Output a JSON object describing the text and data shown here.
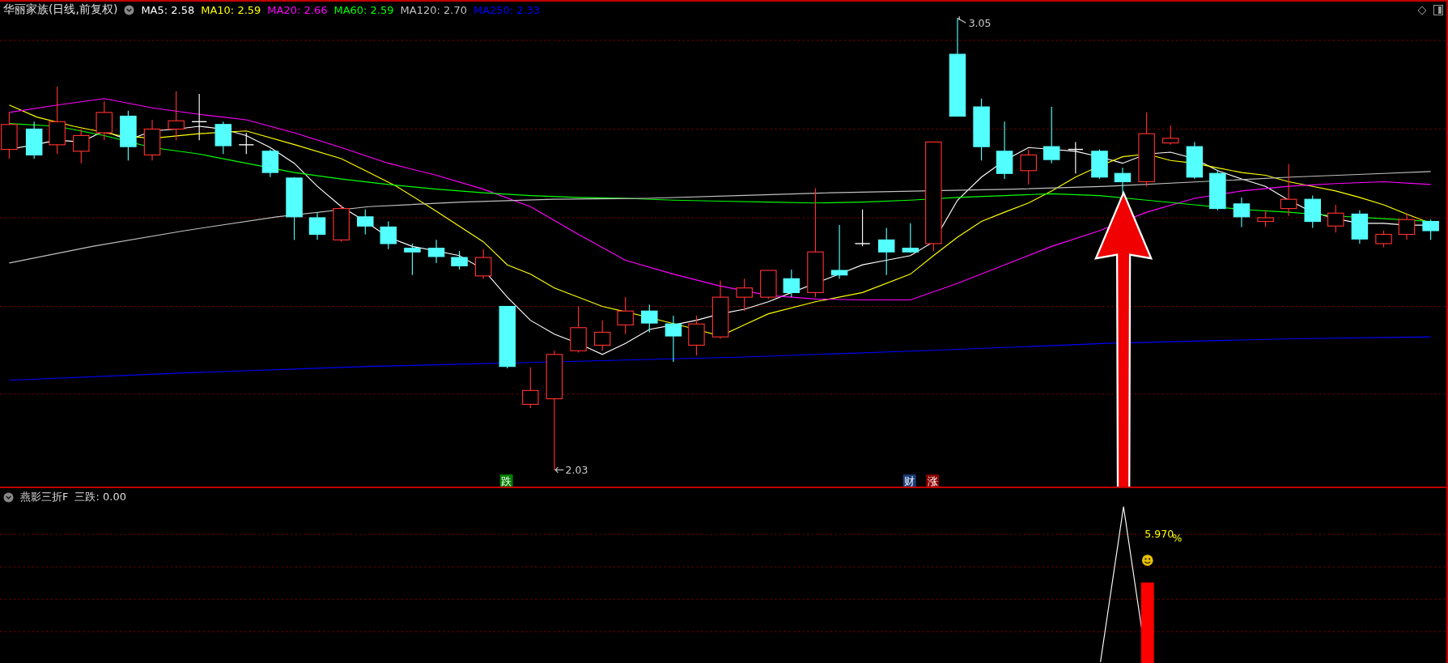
{
  "main_chart": {
    "title": "华丽家族(日线,前复权)",
    "moving_averages": [
      {
        "label": "MA5: 2.58",
        "color": "#ffffff"
      },
      {
        "label": "MA10: 2.59",
        "color": "#ffff00"
      },
      {
        "label": "MA20: 2.66",
        "color": "#ff00ff"
      },
      {
        "label": "MA60: 2.59",
        "color": "#00ff00"
      },
      {
        "label": "MA120: 2.70",
        "color": "#c0c0c0"
      },
      {
        "label": "MA250: 2.33",
        "color": "#0000ff"
      }
    ],
    "high_label": "3.05",
    "low_label": "2.03",
    "event_markers": [
      {
        "text": "跌",
        "color": "#008000"
      },
      {
        "text": "财",
        "color": "#1a3d7a"
      },
      {
        "text": "涨",
        "color": "#8b0000"
      }
    ]
  },
  "indicator_panel": {
    "title": "燕影三折F",
    "reading": "三跌: 0.00",
    "value_label": "5.970",
    "unit": "%"
  }
}
